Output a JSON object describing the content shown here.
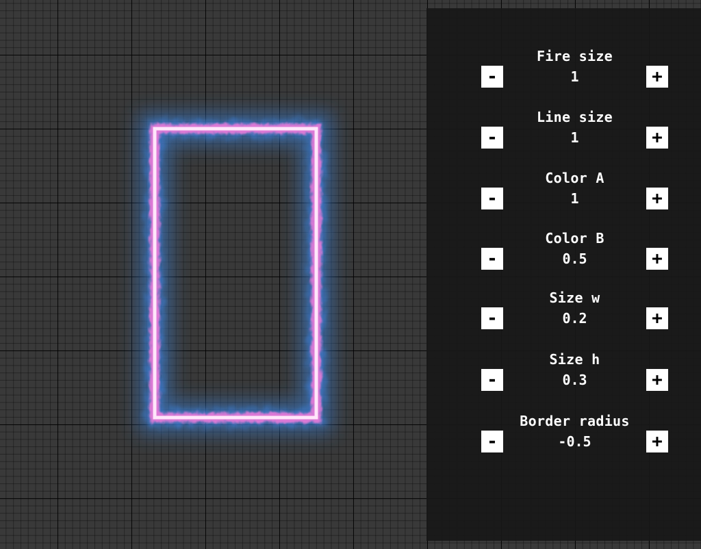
{
  "canvas": {
    "background_color": "#393939",
    "grid_line_color": "#000000",
    "glow_outer_color": "#3d7fd6",
    "glow_inner_color": "#e67ad8",
    "core_color": "#ffe6fa"
  },
  "controls": [
    {
      "label": "Fire size",
      "value": "1",
      "minus": "-",
      "plus": "+"
    },
    {
      "label": "Line size",
      "value": "1",
      "minus": "-",
      "plus": "+"
    },
    {
      "label": "Color A",
      "value": "1",
      "minus": "-",
      "plus": "+"
    },
    {
      "label": "Color B",
      "value": "0.5",
      "minus": "-",
      "plus": "+"
    },
    {
      "label": "Size w",
      "value": "0.2",
      "minus": "-",
      "plus": "+"
    },
    {
      "label": "Size h",
      "value": "0.3",
      "minus": "-",
      "plus": "+"
    },
    {
      "label": "Border radius",
      "value": "-0.5",
      "minus": "-",
      "plus": "+"
    }
  ]
}
